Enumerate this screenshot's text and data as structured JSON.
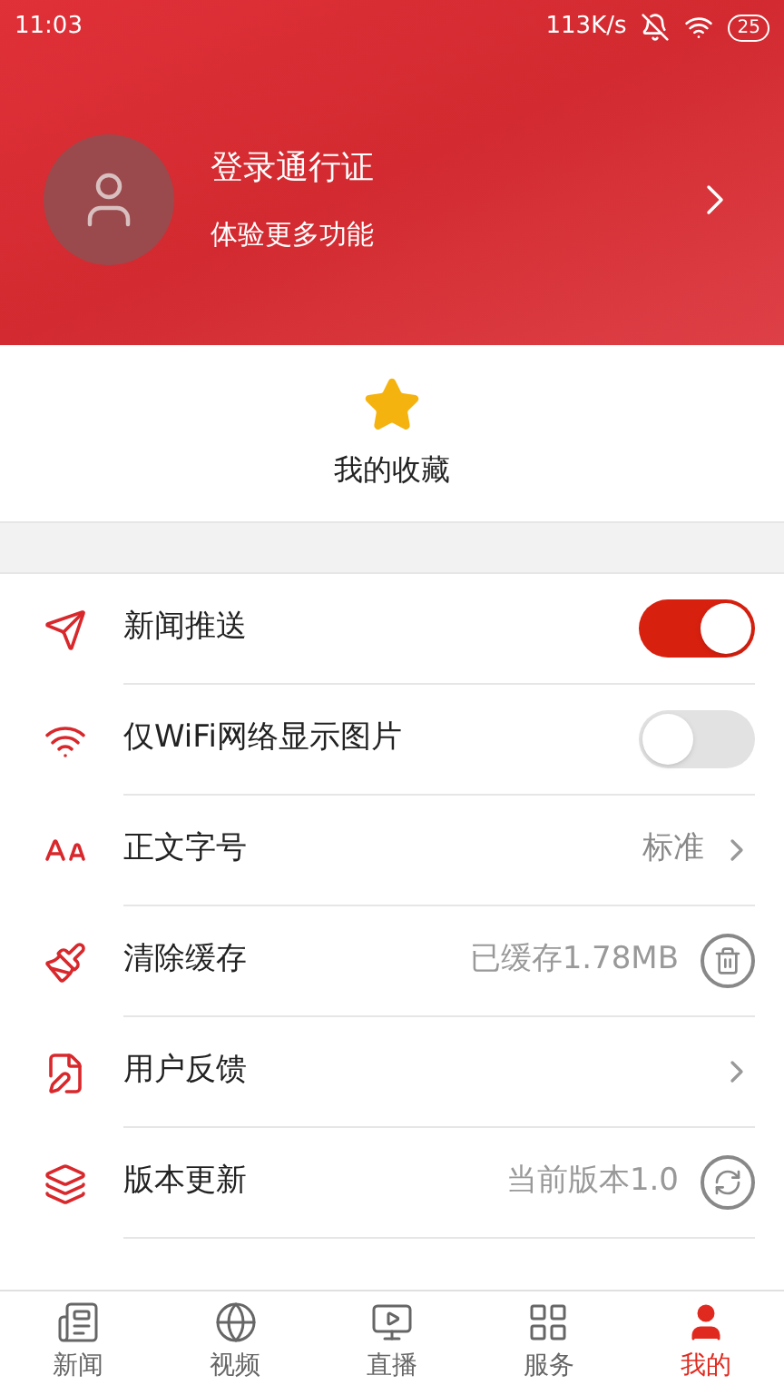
{
  "status_bar": {
    "time": "11:03",
    "speed": "113K/s",
    "battery": "25"
  },
  "profile": {
    "title": "登录通行证",
    "subtitle": "体验更多功能"
  },
  "favorites": {
    "label": "我的收藏"
  },
  "settings": [
    {
      "kind": "toggle",
      "label": "新闻推送",
      "on": true
    },
    {
      "kind": "toggle",
      "label": "仅WiFi网络显示图片",
      "on": false
    },
    {
      "kind": "value-chevron",
      "label": "正文字号",
      "value": "标准"
    },
    {
      "kind": "value-trash",
      "label": "清除缓存",
      "value": "已缓存1.78MB"
    },
    {
      "kind": "chevron",
      "label": "用户反馈"
    },
    {
      "kind": "value-refresh",
      "label": "版本更新",
      "value": "当前版本1.0"
    }
  ],
  "tabs": [
    {
      "label": "新闻",
      "selected": false
    },
    {
      "label": "视频",
      "selected": false
    },
    {
      "label": "直播",
      "selected": false
    },
    {
      "label": "服务",
      "selected": false
    },
    {
      "label": "我的",
      "selected": true
    }
  ]
}
